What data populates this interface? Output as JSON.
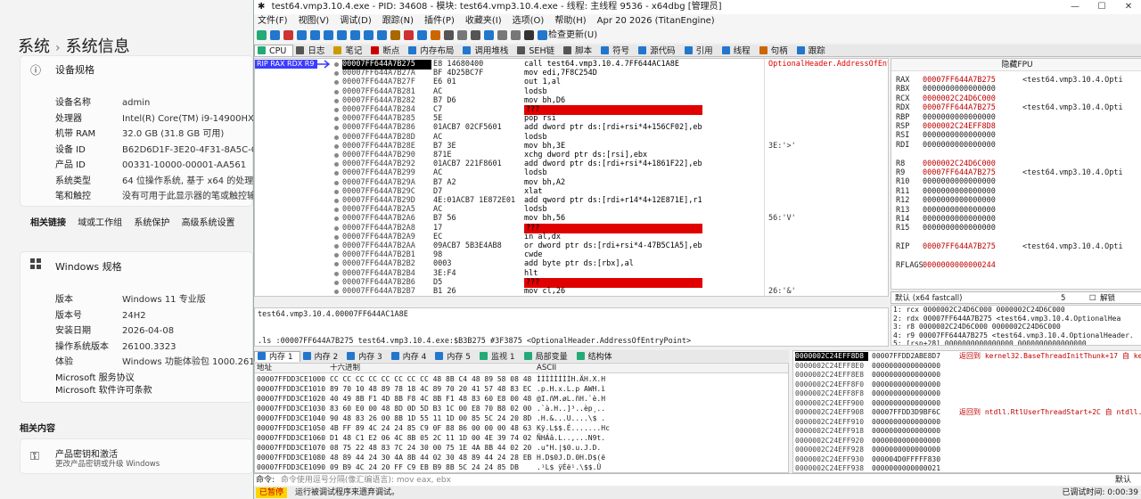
{
  "settings": {
    "breadcrumb": [
      "系统",
      "系统信息"
    ],
    "device_spec_title": "设备规格",
    "device_specs": [
      {
        "k": "设备名称",
        "v": "admin"
      },
      {
        "k": "处理器",
        "v": "Intel(R) Core(TM) i9-14900HX   2.20"
      },
      {
        "k": "机带 RAM",
        "v": "32.0 GB (31.8 GB 可用)"
      },
      {
        "k": "设备 ID",
        "v": "B62D6D1F-3E20-4F31-8A5C-C88E6"
      },
      {
        "k": "产品 ID",
        "v": "00331-10000-00001-AA561"
      },
      {
        "k": "系统类型",
        "v": "64 位操作系统, 基于 x64 的处理器"
      },
      {
        "k": "笔和触控",
        "v": "没有可用于此显示器的笔或触控输入"
      }
    ],
    "related_links_label": "相关链接",
    "related_links": [
      "域或工作组",
      "系统保护",
      "高级系统设置"
    ],
    "windows_spec_title": "Windows 规格",
    "windows_specs": [
      {
        "k": "版本",
        "v": "Windows 11 专业版"
      },
      {
        "k": "版本号",
        "v": "24H2"
      },
      {
        "k": "安装日期",
        "v": "2026-04-08"
      },
      {
        "k": "操作系统版本",
        "v": "26100.3323"
      },
      {
        "k": "体验",
        "v": "Windows 功能体验包 1000.26100.5"
      }
    ],
    "ms_links": [
      "Microsoft 服务协议",
      "Microsoft 软件许可条款"
    ],
    "related_content_label": "相关内容",
    "product_key_title": "产品密钥和激活",
    "product_key_sub": "更改产品密钥或升级 Windows"
  },
  "debugger": {
    "title": "test64.vmp3.10.4.exe - PID: 34608 - 模块: test64.vmp3.10.4.exe - 线程: 主线程 9536 - x64dbg [管理员]",
    "menu": [
      "文件(F)",
      "视图(V)",
      "调试(D)",
      "跟踪(N)",
      "插件(P)",
      "收藏夹(I)",
      "选项(O)",
      "帮助(H)",
      "Apr 20 2026 (TitanEngine)"
    ],
    "check_update": "检查更新(U)",
    "tabs": [
      "CPU",
      "日志",
      "笔记",
      "断点",
      "内存布局",
      "调用堆栈",
      "SEH链",
      "脚本",
      "符号",
      "源代码",
      "引用",
      "线程",
      "句柄",
      "跟踪"
    ],
    "rip_label": "RIP RAX RDX R9",
    "disasm": [
      {
        "a": "00007FF644A7B275",
        "b": "E8 14680400",
        "i": "call test64.vmp3.10.4.7FF644AC1A8E",
        "c": "OptionalHeader.AddressOfEntryPoint",
        "cur": true
      },
      {
        "a": "00007FF644A7B27A",
        "b": "BF 4D25BC7F",
        "i": "mov edi,7F8C254D",
        "c": ""
      },
      {
        "a": "00007FF644A7B27F",
        "b": "E6 01",
        "i": "out 1,al",
        "c": ""
      },
      {
        "a": "00007FF644A7B281",
        "b": "AC",
        "i": "lodsb",
        "c": ""
      },
      {
        "a": "00007FF644A7B282",
        "b": "B7 D6",
        "i": "mov bh,D6",
        "c": ""
      },
      {
        "a": "00007FF644A7B284",
        "b": "C7",
        "i": "???",
        "c": ""
      },
      {
        "a": "00007FF644A7B285",
        "b": "5E",
        "i": "pop rsi",
        "c": ""
      },
      {
        "a": "00007FF644A7B286",
        "b": "01ACB7 02CF5601",
        "i": "add dword ptr ds:[rdi+rsi*4+156CF02],ebp",
        "c": ""
      },
      {
        "a": "00007FF644A7B28D",
        "b": "AC",
        "i": "lodsb",
        "c": ""
      },
      {
        "a": "00007FF644A7B28E",
        "b": "B7 3E",
        "i": "mov bh,3E",
        "c": "3E:'>'"
      },
      {
        "a": "00007FF644A7B290",
        "b": "871E",
        "i": "xchg dword ptr ds:[rsi],ebx",
        "c": ""
      },
      {
        "a": "00007FF644A7B292",
        "b": "01ACB7 221F8601",
        "i": "add dword ptr ds:[rdi+rsi*4+1861F22],ebp",
        "c": ""
      },
      {
        "a": "00007FF644A7B299",
        "b": "AC",
        "i": "lodsb",
        "c": ""
      },
      {
        "a": "00007FF644A7B29A",
        "b": "B7 A2",
        "i": "mov bh,A2",
        "c": ""
      },
      {
        "a": "00007FF644A7B29C",
        "b": "D7",
        "i": "xlat",
        "c": ""
      },
      {
        "a": "00007FF644A7B29D",
        "b": "4E:01ACB7 1E872E01",
        "i": "add qword ptr ds:[rdi+r14*4+12E871E],r13",
        "c": ""
      },
      {
        "a": "00007FF644A7B2A5",
        "b": "AC",
        "i": "lodsb",
        "c": ""
      },
      {
        "a": "00007FF644A7B2A6",
        "b": "B7 56",
        "i": "mov bh,56",
        "c": "56:'V'"
      },
      {
        "a": "00007FF644A7B2A8",
        "b": "17",
        "i": "???",
        "c": ""
      },
      {
        "a": "00007FF644A7B2A9",
        "b": "EC",
        "i": "in al,dx",
        "c": ""
      },
      {
        "a": "00007FF644A7B2AA",
        "b": "09ACB7 5B3E4AB8",
        "i": "or dword ptr ds:[rdi+rsi*4-47B5C1A5],ebp",
        "c": ""
      },
      {
        "a": "00007FF644A7B2B1",
        "b": "98",
        "i": "cwde",
        "c": ""
      },
      {
        "a": "00007FF644A7B2B2",
        "b": "0003",
        "i": "add byte ptr ds:[rbx],al",
        "c": ""
      },
      {
        "a": "00007FF644A7B2B4",
        "b": "3E:F4",
        "i": "hlt",
        "c": ""
      },
      {
        "a": "00007FF644A7B2B6",
        "b": "D5",
        "i": "???",
        "c": ""
      },
      {
        "a": "00007FF644A7B2B7",
        "b": "B1 26",
        "i": "mov cl,26",
        "c": "26:'&'"
      }
    ],
    "regs_title": "隐藏FPU",
    "regs": [
      {
        "n": "RAX",
        "v": "00007FF644A7B275",
        "c": "<test64.vmp3.10.4.Opti",
        "red": true
      },
      {
        "n": "RBX",
        "v": "0000000000000000",
        "c": "",
        "red": false
      },
      {
        "n": "RCX",
        "v": "0000002C24D6C000",
        "c": "",
        "red": true
      },
      {
        "n": "RDX",
        "v": "00007FF644A7B275",
        "c": "<test64.vmp3.10.4.Opti",
        "red": true
      },
      {
        "n": "RBP",
        "v": "0000000000000000",
        "c": "",
        "red": false
      },
      {
        "n": "RSP",
        "v": "0000002C24EFF8D8",
        "c": "",
        "red": true
      },
      {
        "n": "RSI",
        "v": "0000000000000000",
        "c": "",
        "red": false
      },
      {
        "n": "RDI",
        "v": "0000000000000000",
        "c": "",
        "red": false
      },
      {
        "n": "",
        "v": "",
        "c": "",
        "red": false
      },
      {
        "n": "R8",
        "v": "0000002C24D6C000",
        "c": "",
        "red": true
      },
      {
        "n": "R9",
        "v": "00007FF644A7B275",
        "c": "<test64.vmp3.10.4.Opti",
        "red": true
      },
      {
        "n": "R10",
        "v": "0000000000000000",
        "c": "",
        "red": false
      },
      {
        "n": "R11",
        "v": "0000000000000000",
        "c": "",
        "red": false
      },
      {
        "n": "R12",
        "v": "0000000000000000",
        "c": "",
        "red": false
      },
      {
        "n": "R13",
        "v": "0000000000000000",
        "c": "",
        "red": false
      },
      {
        "n": "R14",
        "v": "0000000000000000",
        "c": "",
        "red": false
      },
      {
        "n": "R15",
        "v": "0000000000000000",
        "c": "",
        "red": false
      },
      {
        "n": "",
        "v": "",
        "c": "",
        "red": false
      },
      {
        "n": "RIP",
        "v": "00007FF644A7B275",
        "c": "<test64.vmp3.10.4.Opti",
        "red": true
      },
      {
        "n": "",
        "v": "",
        "c": "",
        "red": false
      },
      {
        "n": "RFLAGS",
        "v": "0000000000000244",
        "c": "",
        "red": true
      }
    ],
    "callconv": "默认 (x64 fastcall)",
    "callconv_count": "5",
    "callconv_unlock": "解锁",
    "args": [
      "1: rcx 0000002C24D6C000 0000002C24D6C000",
      "2: rdx 00007FF644A7B275 <test64.vmp3.10.4.OptionalHea",
      "3: r8 0000002C24D6C000 0000002C24D6C000",
      "4: r9 00007FF644A7B275 <test64.vmp3.10.4.OptionalHeader.",
      "5: [rsp+28] 0000000000000000 0000000000000000"
    ],
    "info": [
      "test64.vmp3.10.4.00007FF644AC1A8E",
      ".ls :00007FF644A7B275 test64.vmp3.10.4.exe:$B3B275 #3F3875 <OptionalHeader.AddressOfEntryPoint>"
    ],
    "dump_tabs": [
      "内存 1",
      "内存 2",
      "内存 3",
      "内存 4",
      "内存 5",
      "监视 1",
      "局部变量",
      "结构体"
    ],
    "dump_headers": [
      "地址",
      "十六进制",
      "ASCII"
    ],
    "dump": [
      {
        "a": "00007FFDD3CE1000",
        "h": "CC CC CC CC CC CC CC CC 48 8B C4 48 89 58 08 48",
        "s": "ÌÌÌÌÌÌÌÌH.ÄH.X.H"
      },
      {
        "a": "00007FFDD3CE1010",
        "h": "89 70 10 48 89 78 18 4C 89 70 20 41 57 48 83 EC",
        "s": ".p.H.x.L.p AWH.ì"
      },
      {
        "a": "00007FFDD3CE1020",
        "h": "40 49 8B F1 4D 8B F8 4C 8B F1 48 83 60 E8 00 48",
        "s": "@I.ñM.øL.ñH.`è.H"
      },
      {
        "a": "00007FFDD3CE1030",
        "h": "83 60 E0 00 48 8D 0D 5D B3 1C 00 E8 70 B8 02 00",
        "s": ".`à.H..]³..èp¸.."
      },
      {
        "a": "00007FFDD3CE1040",
        "h": "90 48 83 26 00 8B 1D 55 11 1D 00 85 5C 24 20 8D",
        "s": ".H.&...U....\\$ ."
      },
      {
        "a": "00007FFDD3CE1050",
        "h": "4B FF 89 4C 24 24 85 C9 0F 88 86 00 00 00 48 63",
        "s": "Kÿ.L$$.É.......Hc"
      },
      {
        "a": "00007FFDD3CE1060",
        "h": "D1 48 C1 E2 06 4C 8B 05 2C 11 1D 00 4E 39 74 02",
        "s": "ÑHÁâ.L..,...N9t."
      },
      {
        "a": "00007FFDD3CE1070",
        "h": "08 75 22 48 83 7C 24 30 00 75 1E 4A 8B 44 02 20",
        "s": ".u\"H.|$0.u.J.D. "
      },
      {
        "a": "00007FFDD3CE1080",
        "h": "48 89 44 24 30 4A 8B 44 02 30 48 89 44 24 28 EB",
        "s": "H.D$0J.D.0H.D$(ë"
      },
      {
        "a": "00007FFDD3CE1090",
        "h": "09 B9 4C 24 20 FF C9 EB B9 8B 5C 24 24 85 DB",
        "s": ".¹L$ ÿÉë¹.\\$$.Û"
      }
    ],
    "stack": [
      {
        "a": "0000002C24EFF8D8",
        "v": "00007FFDD2ABE8D7",
        "c": "返回到 kernel32.BaseThreadInitThunk+17 自 ker",
        "cur": true
      },
      {
        "a": "0000002C24EFF8E0",
        "v": "0000000000000000",
        "c": ""
      },
      {
        "a": "0000002C24EFF8E8",
        "v": "0000000000000000",
        "c": ""
      },
      {
        "a": "0000002C24EFF8F0",
        "v": "0000000000000000",
        "c": ""
      },
      {
        "a": "0000002C24EFF8F8",
        "v": "0000000000000000",
        "c": ""
      },
      {
        "a": "0000002C24EFF900",
        "v": "0000000000000000",
        "c": ""
      },
      {
        "a": "0000002C24EFF908",
        "v": "00007FFDD3D9BF6C",
        "c": "返回到 ntdll.RtlUserThreadStart+2C 自 ntdll.R"
      },
      {
        "a": "0000002C24EFF910",
        "v": "0000000000000000",
        "c": ""
      },
      {
        "a": "0000002C24EFF918",
        "v": "0000000000000000",
        "c": ""
      },
      {
        "a": "0000002C24EFF920",
        "v": "0000000000000000",
        "c": ""
      },
      {
        "a": "0000002C24EFF928",
        "v": "0000000000000000",
        "c": ""
      },
      {
        "a": "0000002C24EFF930",
        "v": "000004D0FFFFF830",
        "c": ""
      },
      {
        "a": "0000002C24EFF938",
        "v": "0000000000000021",
        "c": ""
      }
    ],
    "cmd_label": "命令:",
    "cmd_placeholder": "命令使用逗号分隔(像汇编语言): mov eax, ebx",
    "cmd_default": "默认",
    "status_paused": "已暂停",
    "status_msg": "运行被调试程序来遗弃调试。",
    "status_time": "已调试时间: 0:00:39"
  },
  "colors": {
    "accent": "#3c3cff",
    "red": "#c00000",
    "cyan": "#00e0ff",
    "paused": "#ffd400"
  }
}
